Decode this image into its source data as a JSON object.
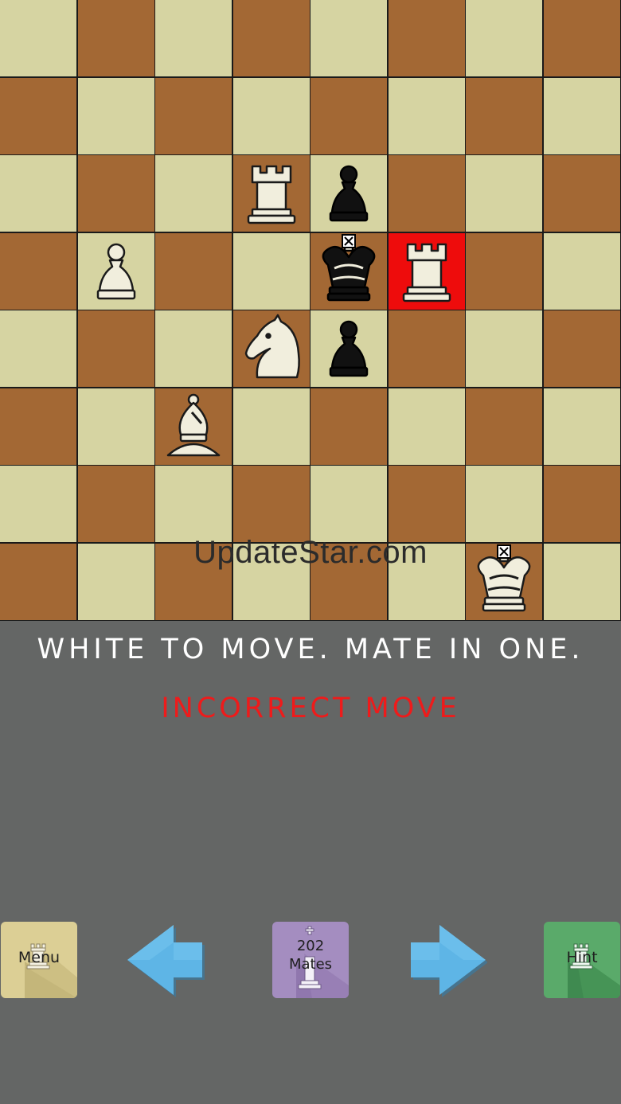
{
  "board": {
    "light_color": "#d6d4a2",
    "dark_color": "#a36834",
    "highlight_color": "#ee0c0c",
    "highlighted_square": "f5",
    "pieces": [
      {
        "square": "d6",
        "piece": "rook",
        "color": "white"
      },
      {
        "square": "e6",
        "piece": "pawn",
        "color": "black"
      },
      {
        "square": "b5",
        "piece": "pawn",
        "color": "white"
      },
      {
        "square": "e5",
        "piece": "king",
        "color": "black"
      },
      {
        "square": "f5",
        "piece": "rook",
        "color": "white"
      },
      {
        "square": "d4",
        "piece": "knight",
        "color": "white"
      },
      {
        "square": "e4",
        "piece": "pawn",
        "color": "black"
      },
      {
        "square": "c3",
        "piece": "bishop",
        "color": "white"
      },
      {
        "square": "g1",
        "piece": "king",
        "color": "white"
      }
    ]
  },
  "watermark": "UpdateStar.com",
  "prompt": "WHITE TO MOVE. MATE IN ONE.",
  "status": "INCORRECT MOVE",
  "toolbar": {
    "menu_label": "Menu",
    "mates_count": "202",
    "mates_label": "Mates",
    "hint_label": "Hint",
    "prev_icon": "arrow-left-icon",
    "next_icon": "arrow-right-icon"
  }
}
